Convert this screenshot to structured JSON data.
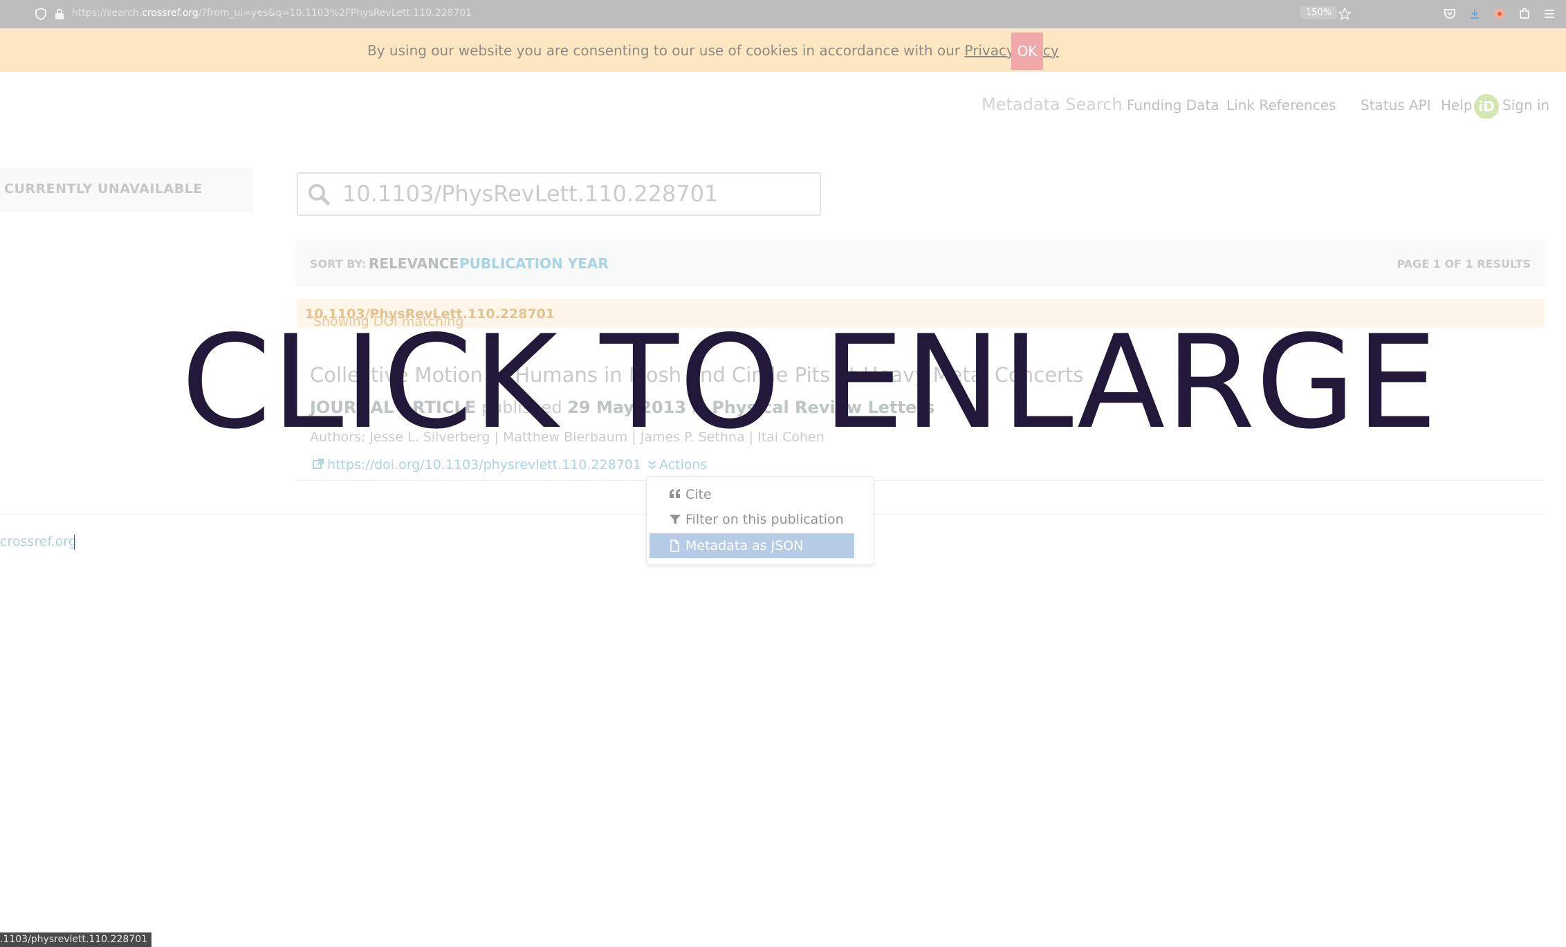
{
  "browser": {
    "url_prefix": "https://search.",
    "url_domain": "crossref.org",
    "url_rest": "/?from_ui=yes&q=10.1103%2FPhysRevLett.110.228701",
    "zoom": "150%",
    "status_url": ".1103/physrevlett.110.228701"
  },
  "cookie": {
    "message": "By using our website you are consenting to our use of cookies in accordance with our ",
    "link": "Privacy Policy",
    "ok": "OK"
  },
  "nav": {
    "items": [
      "Metadata Search",
      "Funding Data",
      "Link References",
      "Status",
      "API",
      "Help"
    ],
    "orcid": "iD",
    "signin": "Sign in"
  },
  "left_panel": {
    "label": "CURRENTLY UNAVAILABLE"
  },
  "search": {
    "value": "10.1103/PhysRevLett.110.228701"
  },
  "sort": {
    "label": "SORT BY:",
    "relevance": "RELEVANCE",
    "year": "PUBLICATION YEAR",
    "page": "PAGE 1 OF 1 RESULTS"
  },
  "doi_banner": {
    "prefix": "Showing DOI matching ",
    "doi": "10.1103/PhysRevLett.110.228701"
  },
  "result": {
    "title": "Collective Motion of Humans in Mosh and Circle Pits at Heavy Metal Concerts",
    "type": "JOURNAL ARTICLE",
    "published_word": " published ",
    "date": "29 May 2013",
    "in_word": " in ",
    "journal": "Physical Review Letters",
    "authors": "Authors: Jesse L. Silverberg | Matthew Bierbaum | James P. Sethna | Itai Cohen",
    "doi_link": "https://doi.org/10.1103/physrevlett.110.228701",
    "actions": "Actions"
  },
  "dropdown": {
    "items": [
      {
        "label": "Cite",
        "icon": "quote-icon"
      },
      {
        "label": "Filter on this publication",
        "icon": "filter-icon"
      },
      {
        "label": "Metadata as JSON",
        "icon": "document-icon"
      }
    ]
  },
  "footer": {
    "link": "crossref.org"
  },
  "overlay": {
    "text": "CLICK TO ENLARGE"
  }
}
